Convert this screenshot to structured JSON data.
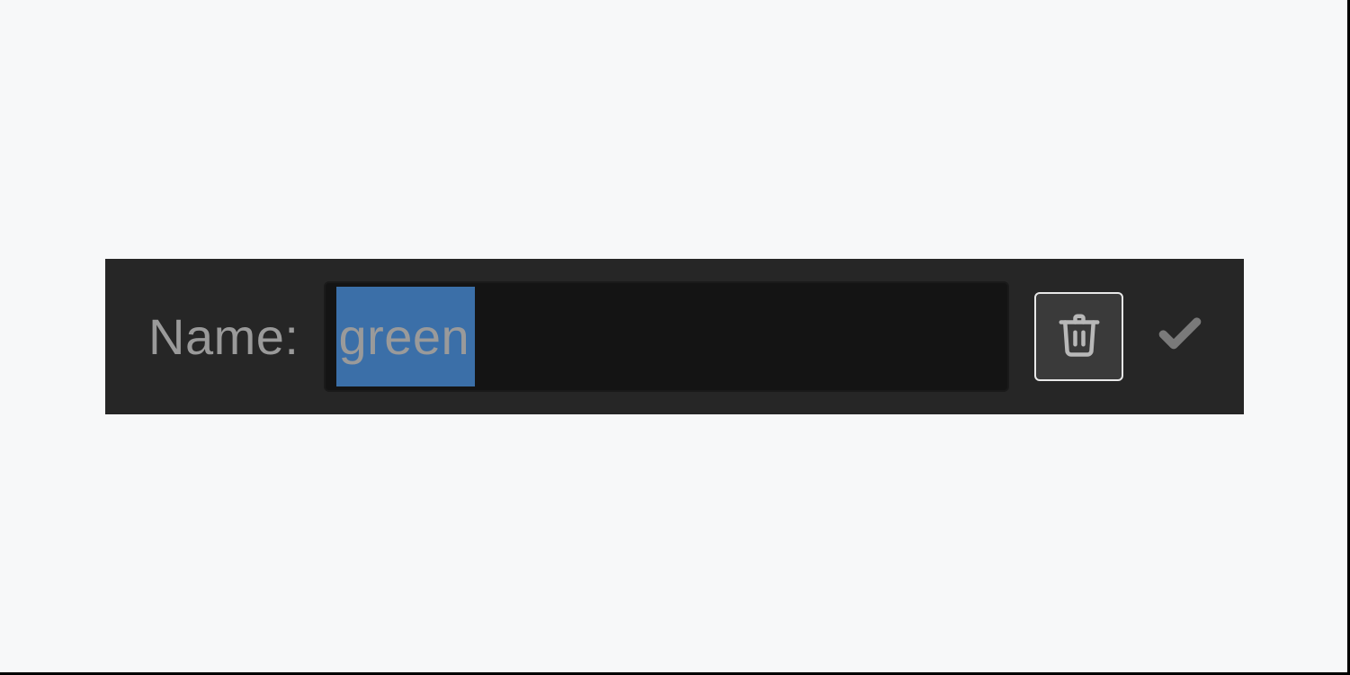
{
  "form": {
    "name_label": "Name:",
    "name_value": "green",
    "name_selected": true
  },
  "icons": {
    "trash": "trash-icon",
    "confirm": "check-icon"
  },
  "colors": {
    "panel_bg": "#262626",
    "input_bg": "#141414",
    "selection_bg": "#3b6fa8",
    "text_muted": "#9a9a9a",
    "button_bg": "#3a3a3a",
    "button_border": "#e8e8e8"
  }
}
